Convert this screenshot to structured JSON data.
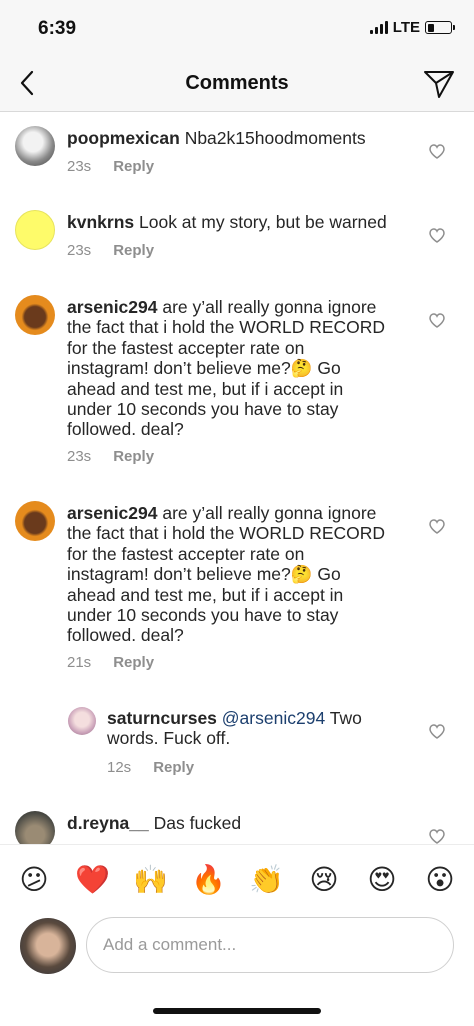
{
  "status_bar": {
    "time": "6:39",
    "network": "LTE"
  },
  "header": {
    "title": "Comments"
  },
  "comments": [
    {
      "username": "poopmexican",
      "text": "Nba2k15hoodmoments",
      "time": "23s",
      "reply": "Reply"
    },
    {
      "username": "kvnkrns",
      "text": "Look at my story, but be warned",
      "time": "23s",
      "reply": "Reply"
    },
    {
      "username": "arsenic294",
      "lines": [
        "are y’all really gonna ignore",
        "the fact that i hold the WORLD RECORD",
        "for the fastest accepter rate on",
        "instagram! don’t believe me?🤔 Go",
        "ahead and test me, but if i accept in",
        "under 10 seconds you have to stay",
        "followed. deal?"
      ],
      "time": "23s",
      "reply": "Reply"
    },
    {
      "username": "arsenic294",
      "lines": [
        "are y’all really gonna ignore",
        "the fact that i hold the WORLD RECORD",
        "for the fastest accepter rate on",
        "instagram! don’t believe me?🤔 Go",
        "ahead and test me, but if i accept in",
        "under 10 seconds you have to stay",
        "followed. deal?"
      ],
      "time": "21s",
      "reply": "Reply"
    },
    {
      "username": "saturncurses",
      "mention": "@arsenic294",
      "line1": "Two",
      "line2": "words. Fuck off.",
      "time": "12s",
      "reply": "Reply"
    },
    {
      "username": "d.reyna__",
      "text": "Das fucked"
    }
  ],
  "emoji_bar": [
    "😕",
    "❤️",
    "🙌",
    "🔥",
    "👏",
    "😢",
    "😍",
    "😮"
  ],
  "composer": {
    "placeholder": "Add a comment..."
  },
  "colors": {
    "text": "#262626",
    "secondary": "#8e8e8e",
    "mention": "#1c3f6e",
    "header_bg": "#f7f7f7"
  }
}
